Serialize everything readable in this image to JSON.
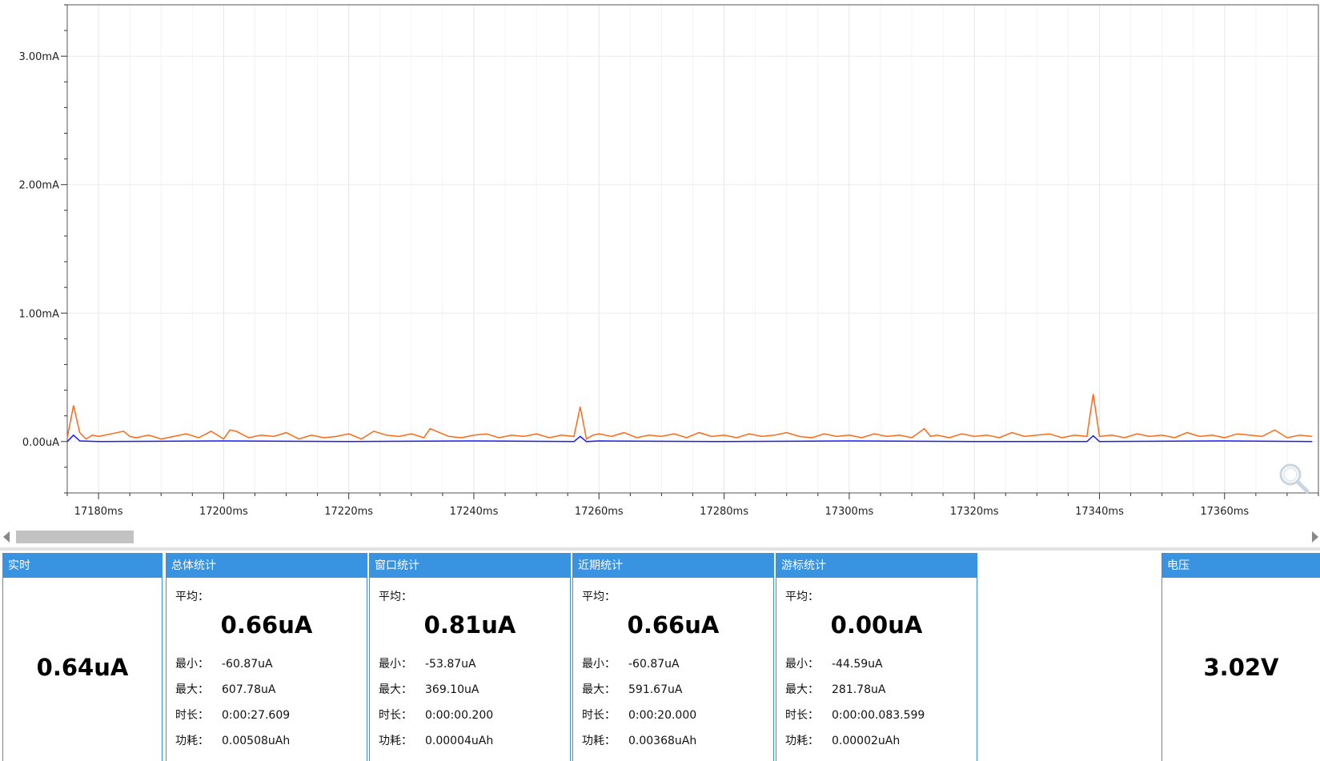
{
  "chart_data": {
    "type": "line",
    "x_unit": "ms",
    "y_unit": "uA",
    "xlim": [
      17175,
      17375
    ],
    "ylim": [
      -400,
      3400
    ],
    "y_ticks": [
      {
        "value": 3000,
        "label": "3.00mA"
      },
      {
        "value": 2000,
        "label": "2.00mA"
      },
      {
        "value": 1000,
        "label": "1.00mA"
      },
      {
        "value": 0,
        "label": "0.00uA"
      }
    ],
    "x_ticks": [
      {
        "value": 17180,
        "label": "17180ms"
      },
      {
        "value": 17200,
        "label": "17200ms"
      },
      {
        "value": 17220,
        "label": "17220ms"
      },
      {
        "value": 17240,
        "label": "17240ms"
      },
      {
        "value": 17260,
        "label": "17260ms"
      },
      {
        "value": 17280,
        "label": "17280ms"
      },
      {
        "value": 17300,
        "label": "17300ms"
      },
      {
        "value": 17320,
        "label": "17320ms"
      },
      {
        "value": 17340,
        "label": "17340ms"
      },
      {
        "value": 17360,
        "label": "17360ms"
      }
    ],
    "grid": true,
    "series": [
      {
        "color": "#ff6a1a",
        "x": [
          17175,
          17176,
          17177,
          17178,
          17179,
          17180,
          17182,
          17184,
          17185,
          17186,
          17188,
          17190,
          17192,
          17194,
          17196,
          17198,
          17200,
          17201,
          17202,
          17204,
          17206,
          17208,
          17210,
          17212,
          17214,
          17216,
          17218,
          17220,
          17222,
          17224,
          17226,
          17228,
          17230,
          17232,
          17233,
          17234,
          17236,
          17238,
          17240,
          17242,
          17244,
          17246,
          17248,
          17250,
          17252,
          17254,
          17256,
          17257,
          17258,
          17259,
          17260,
          17262,
          17264,
          17266,
          17268,
          17270,
          17272,
          17274,
          17276,
          17278,
          17280,
          17282,
          17284,
          17286,
          17288,
          17290,
          17292,
          17294,
          17296,
          17298,
          17300,
          17302,
          17304,
          17306,
          17308,
          17310,
          17312,
          17313,
          17314,
          17316,
          17318,
          17320,
          17322,
          17324,
          17326,
          17328,
          17330,
          17332,
          17334,
          17336,
          17338,
          17339,
          17340,
          17342,
          17344,
          17346,
          17348,
          17350,
          17352,
          17354,
          17356,
          17358,
          17360,
          17362,
          17364,
          17366,
          17368,
          17370,
          17372,
          17374
        ],
        "y": [
          30,
          280,
          70,
          20,
          50,
          40,
          60,
          80,
          40,
          30,
          50,
          20,
          40,
          60,
          30,
          80,
          20,
          90,
          80,
          30,
          50,
          40,
          70,
          20,
          50,
          30,
          40,
          60,
          20,
          80,
          50,
          40,
          60,
          30,
          100,
          80,
          40,
          30,
          50,
          60,
          30,
          50,
          40,
          60,
          30,
          50,
          40,
          270,
          20,
          50,
          60,
          40,
          70,
          30,
          50,
          40,
          60,
          30,
          70,
          40,
          50,
          30,
          60,
          40,
          50,
          70,
          40,
          30,
          60,
          40,
          50,
          30,
          60,
          40,
          50,
          30,
          100,
          40,
          50,
          30,
          60,
          40,
          50,
          30,
          70,
          40,
          50,
          60,
          30,
          50,
          40,
          370,
          40,
          50,
          30,
          60,
          40,
          50,
          30,
          70,
          40,
          50,
          30,
          60,
          50,
          40,
          90,
          30,
          50,
          40
        ]
      },
      {
        "color": "#1a1aff",
        "x": [
          17175,
          17176,
          17177,
          17180,
          17200,
          17220,
          17240,
          17256,
          17257,
          17258,
          17260,
          17280,
          17300,
          17320,
          17338,
          17339,
          17340,
          17360,
          17374
        ],
        "y": [
          0,
          50,
          5,
          0,
          5,
          0,
          5,
          0,
          40,
          0,
          5,
          0,
          5,
          0,
          0,
          45,
          0,
          5,
          0
        ]
      }
    ]
  },
  "stats": {
    "realtime": {
      "title": "实时",
      "value": "0.64uA"
    },
    "total": {
      "title": "总体统计",
      "avg_label": "平均：",
      "avg": "0.66uA",
      "min_label": "最小：",
      "min": "-60.87uA",
      "max_label": "最大：",
      "max": "607.78uA",
      "dur_label": "时长：",
      "dur": "0:00:27.609",
      "energy_label": "功耗：",
      "energy": "0.00508uAh"
    },
    "window": {
      "title": "窗口统计",
      "avg_label": "平均：",
      "avg": "0.81uA",
      "min_label": "最小：",
      "min": "-53.87uA",
      "max_label": "最大：",
      "max": "369.10uA",
      "dur_label": "时长：",
      "dur": "0:00:00.200",
      "energy_label": "功耗：",
      "energy": "0.00004uAh"
    },
    "recent": {
      "title": "近期统计",
      "avg_label": "平均：",
      "avg": "0.66uA",
      "min_label": "最小：",
      "min": "-60.87uA",
      "max_label": "最大：",
      "max": "591.67uA",
      "dur_label": "时长：",
      "dur": "0:00:20.000",
      "energy_label": "功耗：",
      "energy": "0.00368uAh"
    },
    "cursor": {
      "title": "游标统计",
      "avg_label": "平均：",
      "avg": "0.00uA",
      "min_label": "最小：",
      "min": "-44.59uA",
      "max_label": "最大：",
      "max": "281.78uA",
      "dur_label": "时长：",
      "dur": "0:00:00.083.599",
      "energy_label": "功耗：",
      "energy": "0.00002uAh"
    },
    "voltage": {
      "title": "电压",
      "value": "3.02V"
    }
  },
  "icons": {
    "zoom": "magnifier-icon",
    "scroll_left": "arrow-left-icon",
    "scroll_right": "arrow-right-icon"
  }
}
